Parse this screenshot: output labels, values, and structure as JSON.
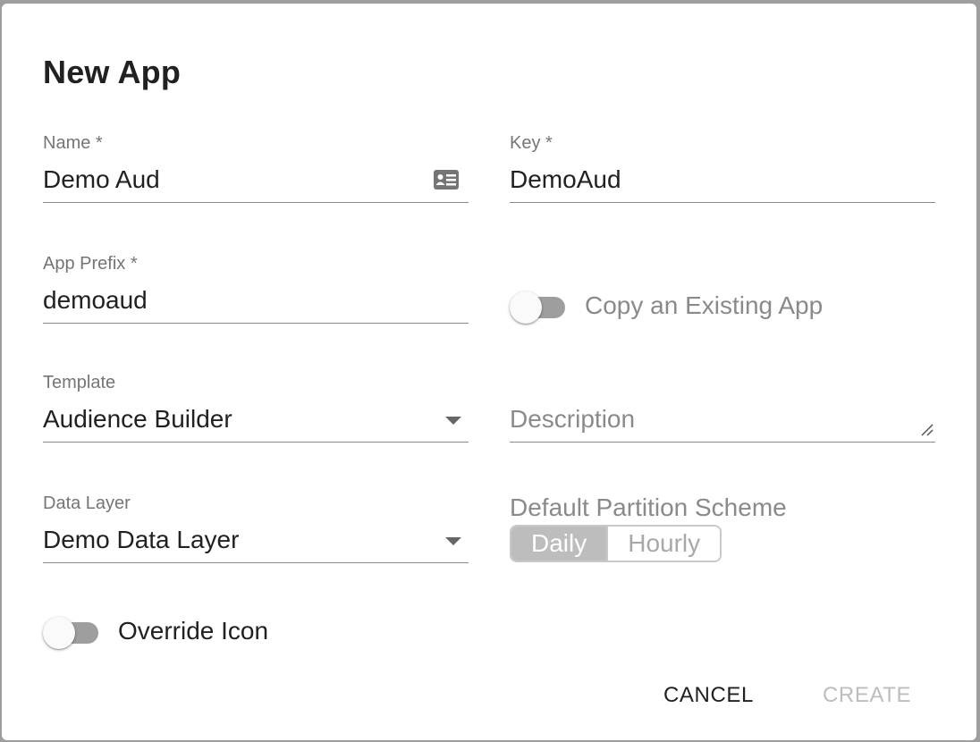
{
  "dialog": {
    "title": "New App"
  },
  "fields": {
    "name": {
      "label": "Name *",
      "value": "Demo Aud"
    },
    "key": {
      "label": "Key *",
      "value": "DemoAud"
    },
    "app_prefix": {
      "label": "App Prefix *",
      "value": "demoaud"
    },
    "template": {
      "label": "Template",
      "value": "Audience Builder"
    },
    "description": {
      "placeholder": "Description",
      "value": ""
    },
    "data_layer": {
      "label": "Data Layer",
      "value": "Demo Data Layer"
    }
  },
  "toggles": {
    "copy_existing": {
      "label": "Copy an Existing App",
      "checked": false
    },
    "override_icon": {
      "label": "Override Icon",
      "checked": false
    }
  },
  "partition": {
    "label": "Default Partition Scheme",
    "options": [
      "Daily",
      "Hourly"
    ],
    "selected": "Daily"
  },
  "actions": {
    "cancel": "CANCEL",
    "create": "CREATE"
  },
  "icons": {
    "name_field_icon": "contact-card-icon",
    "dropdown": "chevron-down-icon",
    "textarea_resize": "resize-handle-icon"
  }
}
